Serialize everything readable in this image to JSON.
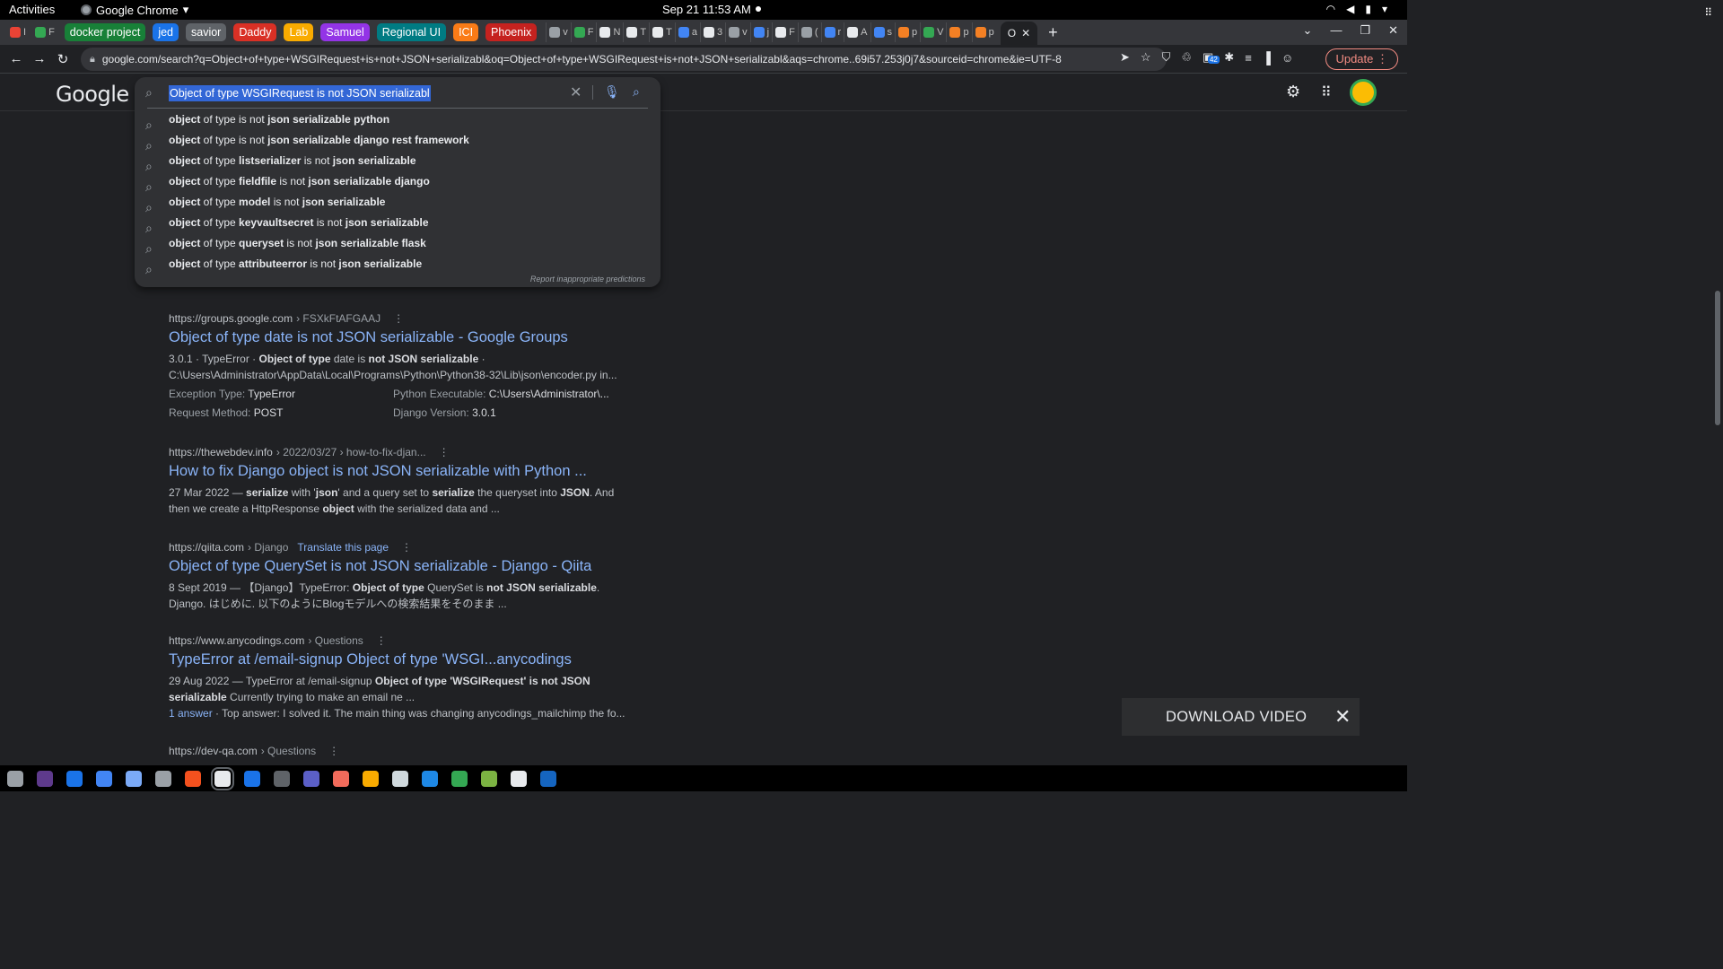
{
  "topbar": {
    "activities": "Activities",
    "app_name": "Google Chrome",
    "clock": "Sep 21  11:53 AM"
  },
  "tabs": {
    "first": [
      {
        "label": "I",
        "color": "#ea4335"
      },
      {
        "label": "F",
        "color": "#34a853"
      }
    ],
    "groups": [
      {
        "label": "docker project",
        "color": "#188038"
      },
      {
        "label": "jed",
        "color": "#1a73e8"
      },
      {
        "label": "savior",
        "color": "#5f6368"
      },
      {
        "label": "Daddy",
        "color": "#d93025"
      },
      {
        "label": "Lab",
        "color": "#f9ab00"
      },
      {
        "label": "Samuel",
        "color": "#9334e6"
      },
      {
        "label": "Regional UI",
        "color": "#007b83"
      },
      {
        "label": "ICI",
        "color": "#fa7b17"
      },
      {
        "label": "Phoenix",
        "color": "#c5221f"
      }
    ],
    "mini": [
      {
        "label": "v",
        "color": "#9aa0a6"
      },
      {
        "label": "F",
        "color": "#34a853"
      },
      {
        "label": "N",
        "color": "#e8eaed"
      },
      {
        "label": "T",
        "color": "#e8eaed"
      },
      {
        "label": "T",
        "color": "#e8eaed"
      },
      {
        "label": "a",
        "color": "#4285f4"
      },
      {
        "label": "3",
        "color": "#e8eaed"
      },
      {
        "label": "v",
        "color": "#9aa0a6"
      },
      {
        "label": "j",
        "color": "#4285f4"
      },
      {
        "label": "F",
        "color": "#e8eaed"
      },
      {
        "label": "(",
        "color": "#9aa0a6"
      },
      {
        "label": "r",
        "color": "#4285f4"
      },
      {
        "label": "A",
        "color": "#e8eaed"
      },
      {
        "label": "s",
        "color": "#4285f4"
      },
      {
        "label": "p",
        "color": "#f48024"
      },
      {
        "label": "V",
        "color": "#34a853"
      },
      {
        "label": "p",
        "color": "#f48024"
      },
      {
        "label": "p",
        "color": "#f48024"
      }
    ],
    "active_label": "O",
    "new_tab": "+"
  },
  "toolbar": {
    "url": "google.com/search?q=Object+of+type+WSGIRequest+is+not+JSON+serializabl&oq=Object+of+type+WSGIRequest+is+not+JSON+serializabl&aqs=chrome..69i57.253j0j7&sourceid=chrome&ie=UTF-8",
    "update_label": "Update",
    "badge": "42"
  },
  "google": {
    "logo": "Google",
    "query": "Object of type WSGIRequest is not JSON serializabl",
    "suggestions": [
      {
        "html": "<b>object</b> of type is not <b>json serializable python</b>"
      },
      {
        "html": "<b>object</b> of type is not <b>json serializable django rest framework</b>"
      },
      {
        "html": "<b>object</b> of type <b>listserializer</b> is not <b>json serializable</b>"
      },
      {
        "html": "<b>object</b> of type <b>fieldfile</b> is not <b>json serializable django</b>"
      },
      {
        "html": "<b>object</b> of type <b>model</b> is not <b>json serializable</b>"
      },
      {
        "html": "<b>object</b> of type <b>keyvaultsecret</b> is not <b>json serializable</b>"
      },
      {
        "html": "<b>object</b> of type <b>queryset</b> is not <b>json serializable flask</b>"
      },
      {
        "html": "<b>object</b> of type <b>attributeerror</b> is not <b>json serializable</b>"
      }
    ],
    "report": "Report inappropriate predictions"
  },
  "results": [
    {
      "site": "https://groups.google.com",
      "path": " › FSXkFtAFGAAJ",
      "title": "Object of type date is not JSON serializable - Google Groups",
      "snippet1": "3.0.1 · TypeError · <b>Object of type</b> date is <b>not JSON serializable</b> ·",
      "snippet2": "C:\\Users\\Administrator\\AppData\\Local\\Programs\\Python\\Python38-32\\Lib\\json\\encoder.py in...",
      "kv": [
        {
          "k": "Exception Type: ",
          "v": "TypeError"
        },
        {
          "k": "Python Executable: ",
          "v": "C:\\Users\\Administrator\\..."
        },
        {
          "k": "Request Method: ",
          "v": "POST"
        },
        {
          "k": "Django Version: ",
          "v": "3.0.1"
        }
      ]
    },
    {
      "site": "https://thewebdev.info",
      "path": " › 2022/03/27 › how-to-fix-djan...",
      "title": "How to fix Django object is not JSON serializable with Python ...",
      "snippet1": "27 Mar 2022 — <b>serialize</b> with '<b>json</b>' and a query set to <b>serialize</b> the queryset into <b>JSON</b>. And",
      "snippet2": "then we create a HttpResponse <b>object</b> with the serialized data and ..."
    },
    {
      "site": "https://qiita.com",
      "path": " › Django",
      "translate": "Translate this page",
      "title": "Object of type QuerySet is not JSON serializable - Django - Qiita",
      "snippet1": "8 Sept 2019 — 【Django】TypeError: <b>Object of type</b> QuerySet is <b>not JSON serializable</b>.",
      "snippet2": "Django. はじめに. 以下のようにBlogモデルへの検索結果をそのまま ..."
    },
    {
      "site": "https://www.anycodings.com",
      "path": " › Questions",
      "title": "TypeError at /email-signup Object of type 'WSGI...anycodings",
      "snippet1": "29 Aug 2022 — TypeError at /email-signup <b>Object of type 'WSGIRequest' is not JSON</b>",
      "snippet2": "<b>serializable</b> Currently trying to make an email ne ...",
      "answer": "1 answer",
      "answer_rest": " · Top answer: I solved it. The main thing was changing anycodings_mailchimp the fo..."
    },
    {
      "site": "https://dev-qa.com",
      "path": " › Questions"
    }
  ],
  "download_video": {
    "label": "DOWNLOAD VIDEO"
  },
  "taskbar": {
    "icons": [
      {
        "color": "#9aa0a6"
      },
      {
        "color": "#5e3a8c"
      },
      {
        "color": "#1a73e8"
      },
      {
        "color": "#4285f4"
      },
      {
        "color": "#7baaf7"
      },
      {
        "color": "#9aa0a6"
      },
      {
        "color": "#f4511e"
      },
      {
        "color": "#e8eaed"
      },
      {
        "color": "#1a73e8"
      },
      {
        "color": "#5f6368"
      },
      {
        "color": "#5b5fc7"
      },
      {
        "color": "#f26b5b"
      },
      {
        "color": "#f9ab00"
      },
      {
        "color": "#cfd8dc"
      },
      {
        "color": "#1e88e5"
      },
      {
        "color": "#34a853"
      },
      {
        "color": "#7cb342"
      },
      {
        "color": "#e8eaed"
      },
      {
        "color": "#1565c0"
      }
    ]
  }
}
